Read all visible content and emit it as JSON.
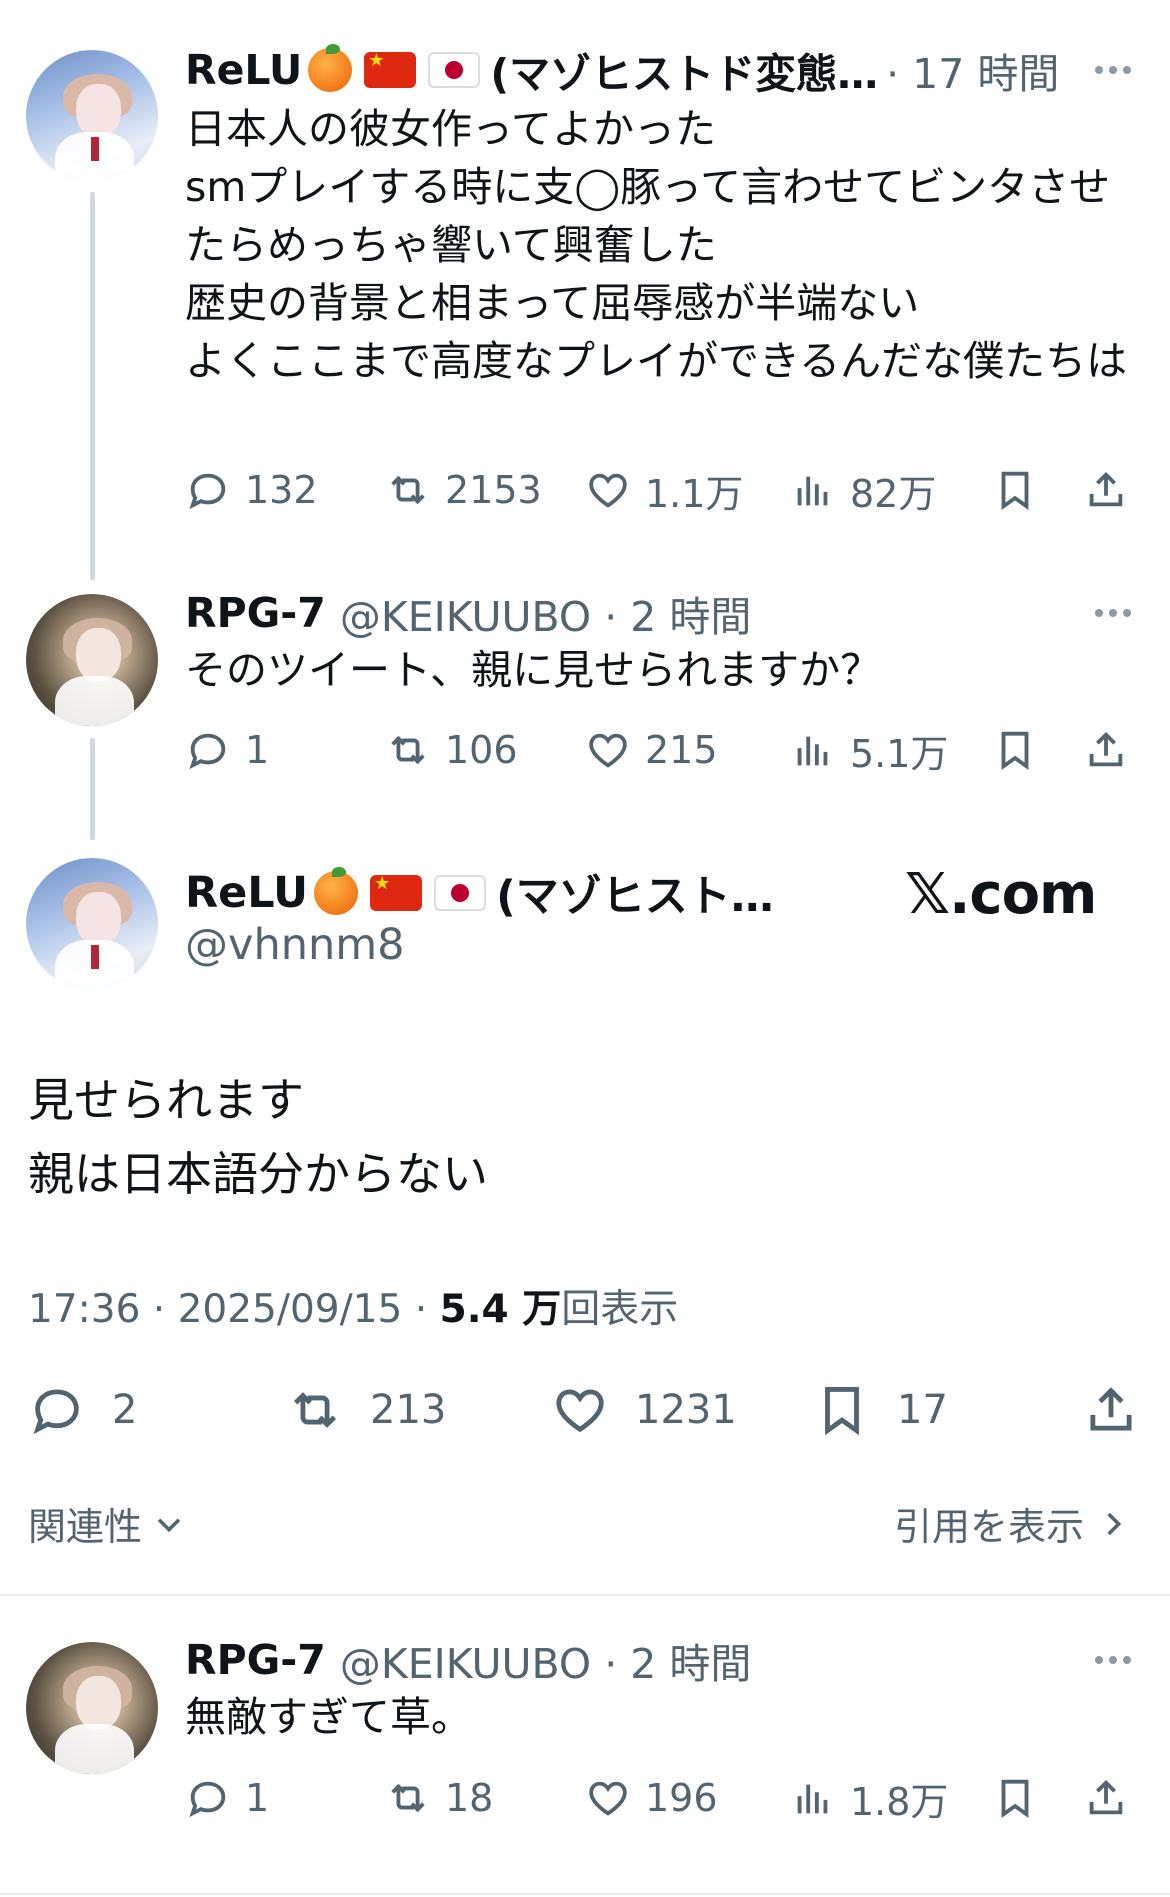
{
  "tweet1": {
    "name": "ReLU",
    "name_suffix": "(マゾヒストド変態…",
    "time": "· 17 時間",
    "text": "日本人の彼女作ってよかった\nsmプレイする時に支◯豚って言わせてビンタさせたらめっちゃ響いて興奮した\n歴史の背景と相まって屈辱感が半端ない\nよくここまで高度なプレイができるんだな僕たちは",
    "replies": "132",
    "retweets": "2153",
    "likes": "1.1万",
    "views": "82万"
  },
  "tweet2": {
    "name": "RPG-7",
    "handle_time": "@KEIKUUBO · 2 時間",
    "text": "そのツイート、親に見せられますか？",
    "replies": "1",
    "retweets": "106",
    "likes": "215",
    "views": "5.1万"
  },
  "main": {
    "name_suffix": "(マゾヒスト…",
    "handle": "@vhnnm8",
    "brand": "𝕏.com",
    "text": "見せられます\n親は日本語分からない",
    "meta_time": "17:36 · 2025/09/15 · ",
    "meta_views": "5.4 万",
    "meta_views_label": "回表示",
    "replies": "2",
    "retweets": "213",
    "likes": "1231",
    "bookmarks": "17",
    "relevance": "関連性",
    "quotes": "引用を表示"
  },
  "tweet3": {
    "name": "RPG-7",
    "handle_time": "@KEIKUUBO · 2 時間",
    "text": "無敵すぎて草。",
    "replies": "1",
    "retweets": "18",
    "likes": "196",
    "views": "1.8万"
  },
  "icons": [
    "reply-icon",
    "retweet-icon",
    "like-icon",
    "views-icon",
    "bookmark-icon",
    "share-icon",
    "more-icon",
    "chevron-down-icon",
    "chevron-right-icon"
  ]
}
